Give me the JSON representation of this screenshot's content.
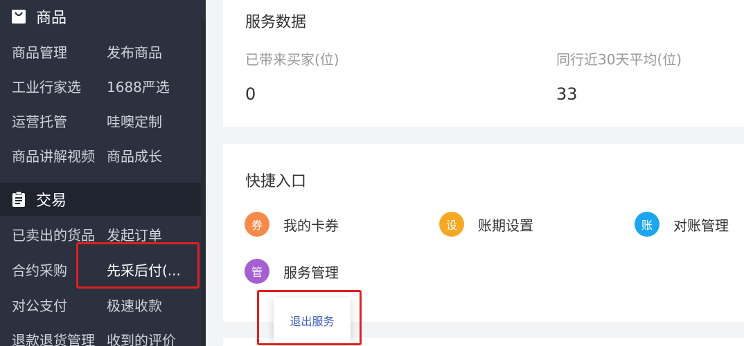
{
  "sidebar": {
    "sections": [
      {
        "title": "商品",
        "icon": "shopping-bag-icon",
        "items": [
          "商品管理",
          "发布商品",
          "工业行家选",
          "1688严选",
          "运营托管",
          "哇噢定制",
          "商品讲解视频",
          "商品成长"
        ]
      },
      {
        "title": "交易",
        "icon": "clipboard-icon",
        "items": [
          "已卖出的货品",
          "发起订单",
          "合约采购",
          "先采后付(...",
          "对公支付",
          "极速收款",
          "退款退货管理",
          "收到的评价"
        ]
      }
    ]
  },
  "service_data": {
    "title": "服务数据",
    "stats": [
      {
        "label": "已带来买家(位)",
        "value": "0"
      },
      {
        "label": "同行近30天平均(位)",
        "value": "33"
      }
    ]
  },
  "quick_entry": {
    "title": "快捷入口",
    "items": [
      {
        "badge": "券",
        "label": "我的卡券",
        "color": "#f58a4b"
      },
      {
        "badge": "设",
        "label": "账期设置",
        "color": "#f7a823"
      },
      {
        "badge": "账",
        "label": "对账管理",
        "color": "#1ca6ef"
      },
      {
        "badge": "管",
        "label": "服务管理",
        "color": "#a55fd3"
      }
    ]
  },
  "popup_menu": {
    "exit_label": "退出服务"
  },
  "colors": {
    "sidebar_bg": "#2b313f",
    "highlight": "#e02020",
    "link": "#3b5cc4"
  }
}
